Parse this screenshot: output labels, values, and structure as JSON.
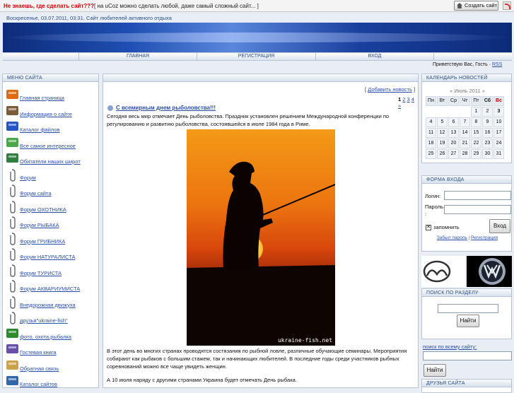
{
  "topbar": {
    "brand": "Не знаешь, где сделать сайт???",
    "message": "[ на uCoz можно сделать любой, даже самый сложный сайт... ]",
    "create_label": "Создать сайт"
  },
  "header": {
    "date_line": "Воскресенье, 03.07.2011, 03:31. Сайт любителей активного отдыха",
    "welcome": "Приветствую Вас, Гость ·",
    "rss": "RSS"
  },
  "nav": {
    "items": [
      "",
      "ГЛАВНАЯ",
      "РЕГИСТРАЦИЯ",
      "ВХОД",
      ""
    ]
  },
  "left": {
    "title": "МЕНЮ САЙТА",
    "items": [
      "Главная страница",
      "Информация о сайте",
      "Каталог файлов",
      "Все самое интересное",
      "Обитатели наших широт",
      "Форум",
      "Форум сайта",
      "Форум ОХОТНИКА",
      "Форум РЫБАКА",
      "Форум ГРИБНИКА",
      "Форум НАТУРАЛИСТА",
      "Форум ТУРИСТА",
      "Форум АКВАРИУМИСТА",
      "Внедорожная движуха",
      "друзья\"ukraine-fish\"",
      "фото, охота,рыбалка",
      "Гостевая книга",
      "Обратная связь",
      "Каталог сайтов"
    ]
  },
  "news": {
    "add_label": "Добавить новость",
    "pages": [
      "1",
      "2",
      "3",
      "4",
      "»"
    ],
    "title": "С всемирным днем рыболовства!!!",
    "intro": "Сегодня весь мир отмечает День рыболовства. Праздник установлен решением Международной конференции по регулированию и развитию рыболовства, состоявшейся в июле 1984 года в Риме.",
    "photo_caption": "ukraine-fish.net",
    "body": "В этот день во многих странах проводятся состязания по рыбной ловле, различные обучающие семинары. Мероприятия собирают как рыбаков с большим стажем, так и начинающих любителей. В последние годы среди участников рыбных соревнований можно все чаще увидеть женщин.",
    "last": "А 10 июля наряду с другими странами Украина будет отмечать День рыбака."
  },
  "calendar": {
    "title": "КАЛЕНДАРЬ НОВОСТЕЙ",
    "month": "«   Июль 2011   »",
    "days": [
      "Пн",
      "Вт",
      "Ср",
      "Чт",
      "Пт",
      "Сб",
      "Вс"
    ],
    "weeks": [
      [
        "",
        "",
        "",
        "",
        "1",
        "2",
        "3"
      ],
      [
        "4",
        "5",
        "6",
        "7",
        "8",
        "9",
        "10"
      ],
      [
        "11",
        "12",
        "13",
        "14",
        "15",
        "16",
        "17"
      ],
      [
        "18",
        "19",
        "20",
        "21",
        "22",
        "23",
        "24"
      ],
      [
        "25",
        "26",
        "27",
        "28",
        "29",
        "30",
        "31"
      ]
    ],
    "weekend_color": "#cc0000"
  },
  "login": {
    "title": "ФОРМА ВХОДА",
    "login_label": "Логин:",
    "password_label": "Пароль :",
    "remember_label": "запомнить",
    "submit": "Вход",
    "forgot": "Забыл пароль",
    "sep": "|",
    "register": "Регистрация"
  },
  "section_search": {
    "title": "ПОИСК ПО РАЗДЕЛУ",
    "button": "Найти"
  },
  "site_search": {
    "title": "поиск по всему сайту:",
    "button": "Найти"
  },
  "friends": {
    "title": "ДРУЗЬЯ САЙТА"
  }
}
